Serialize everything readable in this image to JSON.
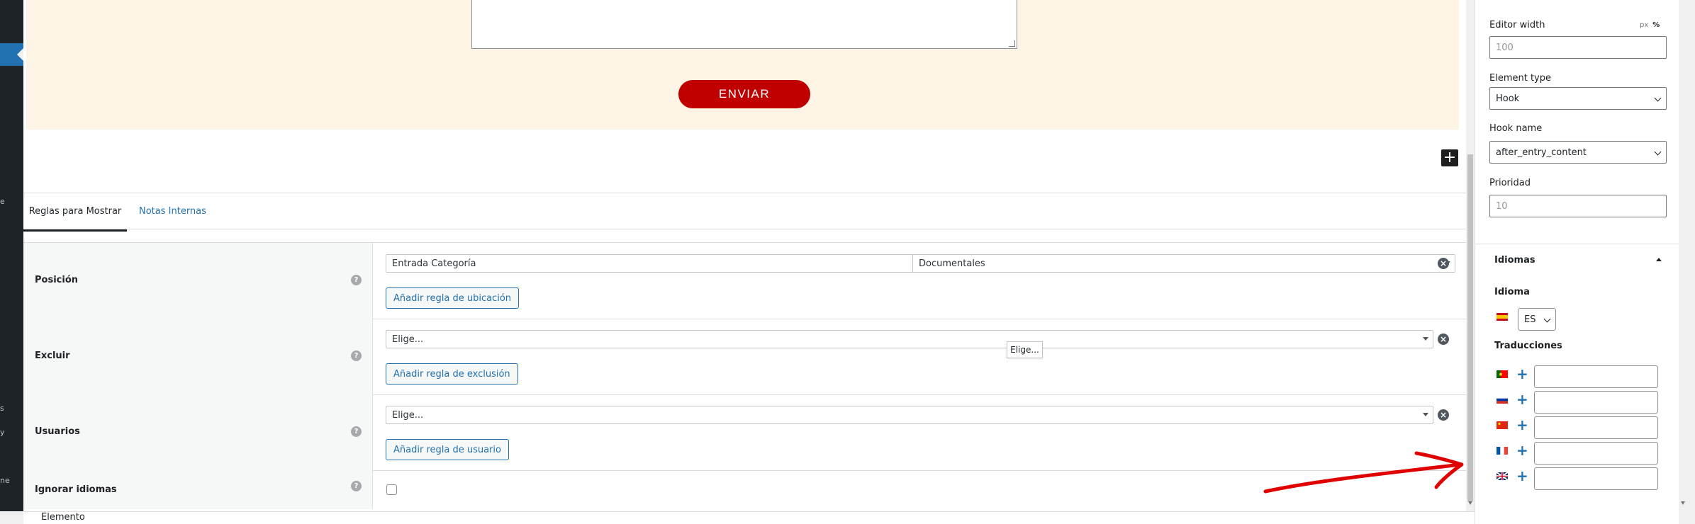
{
  "sidebar": {
    "fragments": [
      "e",
      "s",
      "y",
      "ne"
    ]
  },
  "form": {
    "send_label": "ENVIAR"
  },
  "add_block_symbol": "+",
  "tabs": [
    {
      "label": "Reglas para Mostrar",
      "active": true
    },
    {
      "label": "Notas Internas",
      "active": false
    }
  ],
  "rules": {
    "position": {
      "label": "Posición",
      "select1": "Entrada Categoría",
      "select2": "Documentales",
      "add_button": "Añadir regla de ubicación"
    },
    "exclude": {
      "label": "Excluir",
      "select1": "Elige...",
      "add_button": "Añadir regla de exclusión"
    },
    "users": {
      "label": "Usuarios",
      "select1": "Elige...",
      "add_button": "Añadir regla de usuario"
    },
    "ignore_languages": {
      "label": "Ignorar idiomas",
      "checked": false
    },
    "help_symbol": "?",
    "remove_symbol": "×"
  },
  "tooltip": "Elige...",
  "footer": {
    "breadcrumb": "Elemento"
  },
  "settings": {
    "editor_width": {
      "label": "Editor width",
      "unit_px": "px",
      "unit_pct": "%",
      "placeholder": "100"
    },
    "element_type": {
      "label": "Element type",
      "value": "Hook"
    },
    "hook_name": {
      "label": "Hook name",
      "value": "after_entry_content"
    },
    "priority": {
      "label": "Prioridad",
      "placeholder": "10"
    }
  },
  "languages": {
    "title": "Idiomas",
    "language_label": "Idioma",
    "current": "ES",
    "translations_label": "Traducciones",
    "translations": [
      {
        "lang": "pt",
        "value": ""
      },
      {
        "lang": "ru",
        "value": ""
      },
      {
        "lang": "zh",
        "value": ""
      },
      {
        "lang": "fr",
        "value": ""
      },
      {
        "lang": "en",
        "value": ""
      }
    ]
  },
  "colors": {
    "accent": "#2271b1",
    "send_button": "#c00000",
    "form_background": "#fdf4e6",
    "annotation_arrow": "#e00000"
  }
}
